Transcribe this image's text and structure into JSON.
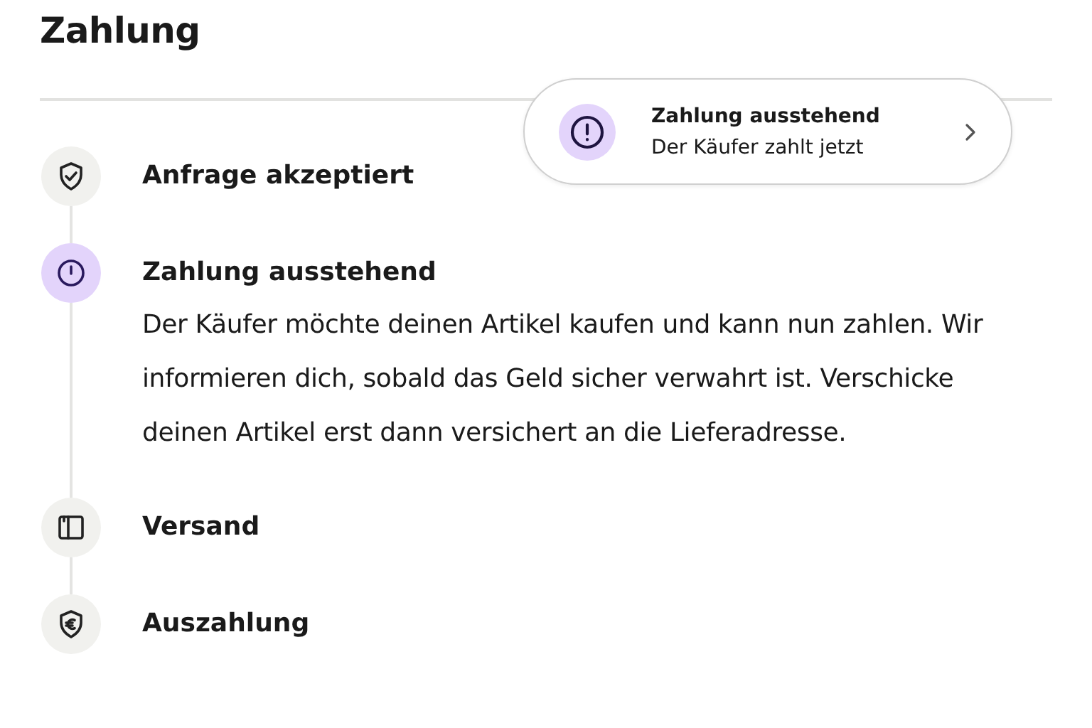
{
  "title": "Zahlung",
  "steps": [
    {
      "current": false,
      "title": "Anfrage akzeptiert"
    },
    {
      "current": true,
      "title": "Zahlung ausstehend",
      "description": "Der Käufer möchte deinen Artikel kaufen und kann nun zahlen. Wir informieren dich, sobald das Geld sicher verwahrt ist. Verschicke deinen Artikel erst dann versichert an die Lieferadresse."
    },
    {
      "current": false,
      "title": "Versand"
    },
    {
      "current": false,
      "title": "Auszahlung"
    }
  ],
  "toast": {
    "title": "Zahlung ausstehend",
    "subtitle": "Der Käufer zahlt jetzt"
  }
}
